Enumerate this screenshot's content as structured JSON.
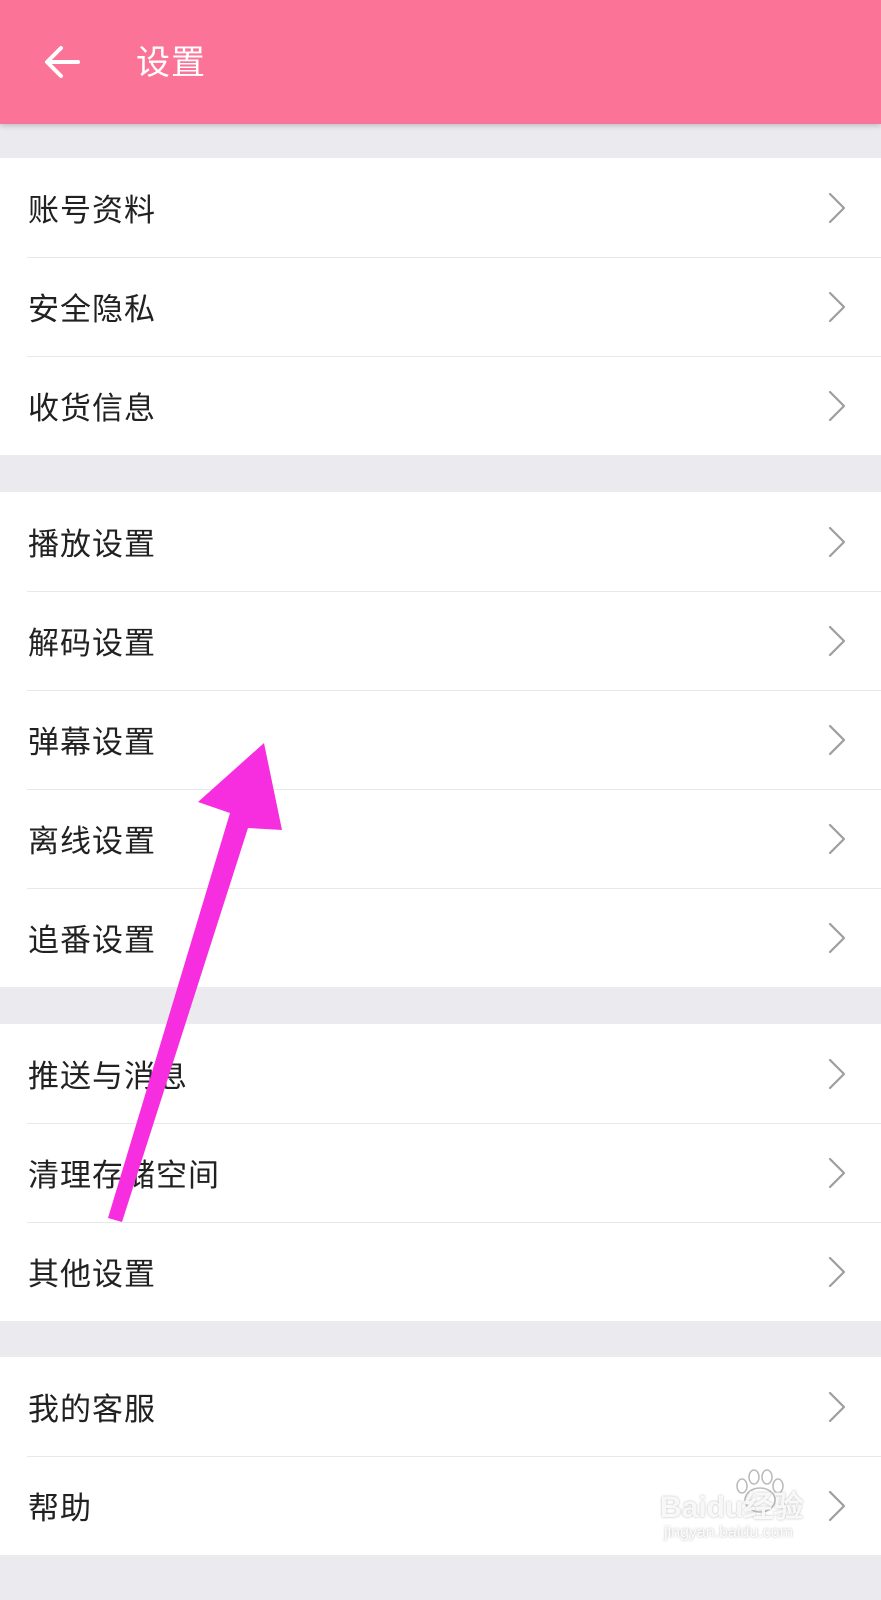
{
  "appbar": {
    "title": "设置",
    "back_icon": "arrow-left-icon",
    "color": "#fb7396"
  },
  "groups": [
    {
      "items": [
        {
          "label": "账号资料"
        },
        {
          "label": "安全隐私"
        },
        {
          "label": "收货信息"
        }
      ]
    },
    {
      "items": [
        {
          "label": "播放设置"
        },
        {
          "label": "解码设置"
        },
        {
          "label": "弹幕设置"
        },
        {
          "label": "离线设置"
        },
        {
          "label": "追番设置"
        }
      ]
    },
    {
      "items": [
        {
          "label": "推送与消息"
        },
        {
          "label": "清理存储空间"
        },
        {
          "label": "其他设置"
        }
      ]
    },
    {
      "items": [
        {
          "label": "我的客服"
        },
        {
          "label": "帮助"
        }
      ]
    }
  ],
  "annotation": {
    "icon": "magenta-arrow-annotation",
    "color": "#f72ee0"
  },
  "watermark": {
    "brand": "Baidu经验",
    "url": "jingyan.baidu.com"
  },
  "colors": {
    "background": "#ebeaee",
    "row_bg": "#ffffff",
    "text": "#212121",
    "chevron": "#9e9e9e"
  }
}
